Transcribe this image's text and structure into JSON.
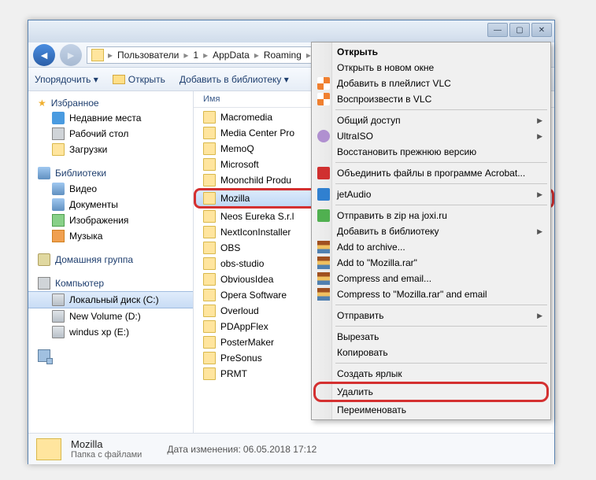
{
  "breadcrumb": {
    "items": [
      "Пользователи",
      "1",
      "AppData",
      "Roaming"
    ]
  },
  "toolbar": {
    "organize": "Упорядочить ▾",
    "open": "Открыть",
    "addlib": "Добавить в библиотеку ▾"
  },
  "sidebar": {
    "favorites": {
      "label": "Избранное",
      "items": [
        "Недавние места",
        "Рабочий стол",
        "Загрузки"
      ]
    },
    "libraries": {
      "label": "Библиотеки",
      "items": [
        "Видео",
        "Документы",
        "Изображения",
        "Музыка"
      ]
    },
    "homegroup": {
      "label": "Домашняя группа"
    },
    "computer": {
      "label": "Компьютер",
      "items": [
        "Локальный диск (C:)",
        "New Volume (D:)",
        "windus xp (E:)"
      ]
    }
  },
  "content": {
    "header": "Имя",
    "files": [
      "Macromedia",
      "Media Center Pro",
      "MemoQ",
      "Microsoft",
      "Moonchild Produ",
      "Mozilla",
      "Neos Eureka S.r.l",
      "NextIconInstaller",
      "OBS",
      "obs-studio",
      "ObviousIdea",
      "Opera Software",
      "Overloud",
      "PDAppFlex",
      "PosterMaker",
      "PreSonus",
      "PRMT"
    ],
    "selected_index": 5
  },
  "status": {
    "name": "Mozilla",
    "type": "Папка с файлами",
    "date_label": "Дата изменения:",
    "date": "06.05.2018 17:12"
  },
  "ctx": {
    "open": "Открыть",
    "open_new": "Открыть в новом окне",
    "add_vlc": "Добавить в плейлист VLC",
    "play_vlc": "Воспроизвести в VLC",
    "share": "Общий доступ",
    "ultraiso": "UltraISO",
    "restore": "Восстановить прежнюю версию",
    "acrobat": "Объединить файлы в программе Acrobat...",
    "jetaudio": "jetAudio",
    "joxi": "Отправить в zip на joxi.ru",
    "addlib": "Добавить в библиотеку",
    "add_archive": "Add to archive...",
    "add_rar": "Add to \"Mozilla.rar\"",
    "compress_email": "Compress and email...",
    "compress_rar_email": "Compress to \"Mozilla.rar\" and email",
    "sendto": "Отправить",
    "cut": "Вырезать",
    "copy": "Копировать",
    "shortcut": "Создать ярлык",
    "delete": "Удалить",
    "rename": "Переименовать"
  }
}
